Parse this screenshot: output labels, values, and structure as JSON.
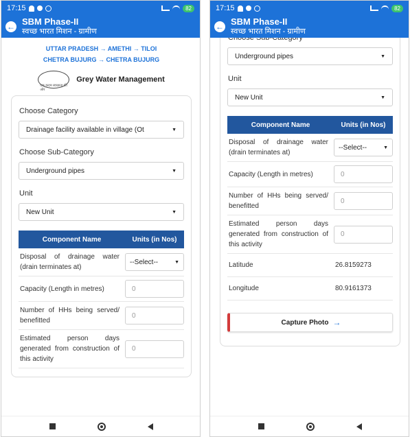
{
  "status": {
    "time": "17:15",
    "battery": "82"
  },
  "app": {
    "title": "SBM Phase-II",
    "subtitle": "स्वच्छ भारत मिशन - ग्रामीण"
  },
  "breadcrumb": {
    "line1": "UTTAR PRADESH → AMETHI → TILOI",
    "line2": "CHETRA BUJURG → CHETRA BUJURG"
  },
  "logo": {
    "tagline": "एक कदम स्वच्छता की ओर",
    "title": "Grey Water Management"
  },
  "form": {
    "category_label": "Choose Category",
    "category_value": "Drainage facility available in village (Ot",
    "subcategory_label": "Choose Sub-Category",
    "subcategory_value": "Underground pipes",
    "unit_label": "Unit",
    "unit_value": "New Unit"
  },
  "table": {
    "headers": [
      "Component Name",
      "Units (in Nos)"
    ],
    "rows": [
      {
        "name": "Disposal of drainage water (drain terminates at)",
        "value": "--Select--"
      },
      {
        "name": "Capacity (Length in metres)",
        "value": "0"
      },
      {
        "name": "Number of HHs being served/ benefitted",
        "value": "0"
      },
      {
        "name": "Estimated person days generated from construction of this activity",
        "value": "0"
      }
    ],
    "latitude_label": "Latitude",
    "latitude_value": "26.8159273",
    "longitude_label": "Longitude",
    "longitude_value": "80.9161373"
  },
  "capture_label": "Capture Photo",
  "colors": {
    "appbar": "#1d72d8",
    "table_header": "#22579e",
    "accent_red": "#d33b3b"
  }
}
